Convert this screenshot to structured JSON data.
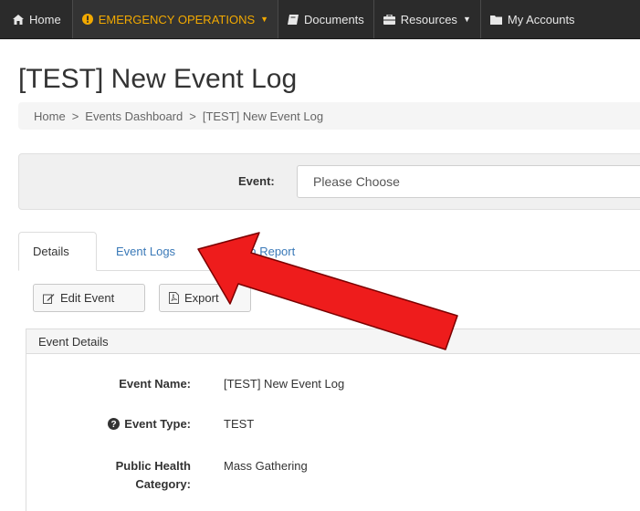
{
  "nav": {
    "home": "Home",
    "emergency": "EMERGENCY OPERATIONS",
    "documents": "Documents",
    "resources": "Resources",
    "accounts": "My Accounts"
  },
  "page_title": "[TEST] New Event Log",
  "breadcrumb": [
    "Home",
    "Events Dashboard",
    "[TEST] New Event Log"
  ],
  "breadcrumb_sep": ">",
  "event_selector": {
    "label": "Event:",
    "value": "Please Choose"
  },
  "tabs": {
    "details": "Details",
    "event_logs": "Event Logs",
    "situation_report": "Situation Report"
  },
  "buttons": {
    "edit": "Edit Event",
    "export": "Export"
  },
  "panel": {
    "heading": "Event Details",
    "rows": [
      {
        "label": "Event Name:",
        "value": "[TEST] New Event Log"
      },
      {
        "label": "Event Type:",
        "value": "TEST"
      },
      {
        "label_line1": "Public Health",
        "label_line2": "Category:",
        "value": "Mass Gathering"
      }
    ]
  },
  "colors": {
    "navbar": "#2b2b2b",
    "emergency": "#f2a900",
    "link": "#3a79b8",
    "arrow": "#ee1c1c"
  },
  "icons": [
    "home-icon",
    "alert-icon",
    "book-icon",
    "briefcase-icon",
    "folder-icon",
    "edit-icon",
    "pdf-icon",
    "question-icon",
    "arrow-annotation"
  ]
}
